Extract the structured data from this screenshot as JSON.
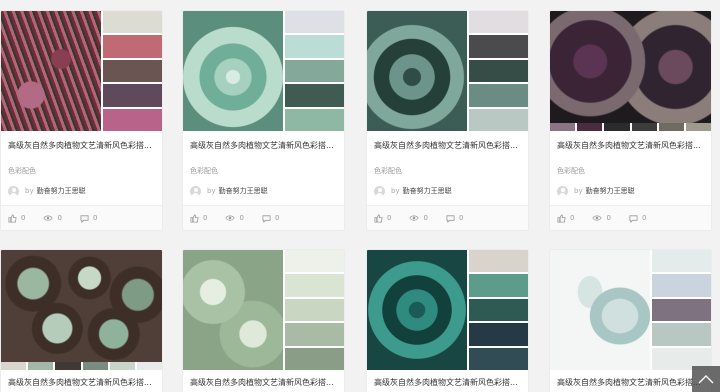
{
  "cards": [
    {
      "title": "高级灰自然多肉植物文艺清新风色彩搭...",
      "tag": "色彩配色",
      "by": "by",
      "author": "勤奋努力王思聪",
      "likes": "0",
      "views": "0",
      "comments": "0",
      "swatches": [
        "#dcdcd2",
        "#c06b74",
        "#6a5552",
        "#5e4a5a",
        "#b8638a"
      ]
    },
    {
      "title": "高级灰自然多肉植物文艺清新风色彩搭...",
      "tag": "色彩配色",
      "by": "by",
      "author": "勤奋努力王思聪",
      "likes": "0",
      "views": "0",
      "comments": "0",
      "swatches": [
        "#dfdfe6",
        "#bcdcd6",
        "#84a89a",
        "#3f5b52",
        "#8fb8a4"
      ]
    },
    {
      "title": "高级灰自然多肉植物文艺清新风色彩搭...",
      "tag": "色彩配色",
      "by": "by",
      "author": "勤奋努力王思聪",
      "likes": "0",
      "views": "0",
      "comments": "0",
      "swatches": [
        "#e2dde0",
        "#4b4a4c",
        "#364c46",
        "#6a8c82",
        "#b9c8c2"
      ]
    },
    {
      "title": "高级灰自然多肉植物文艺清新风色彩搭...",
      "tag": "色彩配色",
      "by": "by",
      "author": "勤奋努力王思聪",
      "likes": "0",
      "views": "0",
      "comments": "0",
      "swatches": [
        "#8a7585",
        "#4a2c3e",
        "#2b2a2c",
        "#3c3d3a",
        "#6e6c60",
        "#9f9a8e"
      ]
    },
    {
      "title": "高级灰自然多肉植物文艺清新风色彩搭...",
      "swatches": [
        "#d9d5cf",
        "#a3b8a6",
        "#3f3835",
        "#7a8c80",
        "#c7d6c8",
        "#e8e9ea"
      ]
    },
    {
      "title": "高级灰自然多肉植物文艺清新风色彩搭...",
      "swatches": [
        "#eef0ea",
        "#d9e4d2",
        "#c9d6c1",
        "#a8bba4",
        "#8a9d86"
      ]
    },
    {
      "title": "高级灰自然多肉植物文艺清新风色彩搭...",
      "swatches": [
        "#d9d4cb",
        "#5d9b8b",
        "#2f5a54",
        "#263a46",
        "#324c56"
      ]
    },
    {
      "title": "高级灰自然多肉植物文艺清新风色彩搭...",
      "swatches": [
        "#e4eceb",
        "#c9d4de",
        "#7f7280",
        "#b9c7c3",
        "#e7ecea"
      ]
    }
  ],
  "icons": {
    "like": "thumb-up-icon",
    "view": "eye-icon",
    "comment": "comment-icon",
    "back_to_top": "back-to-top-icon"
  },
  "colors": {
    "page_bg": "#f2f2f2",
    "card_bg": "#ffffff",
    "meta_text": "#999999"
  }
}
